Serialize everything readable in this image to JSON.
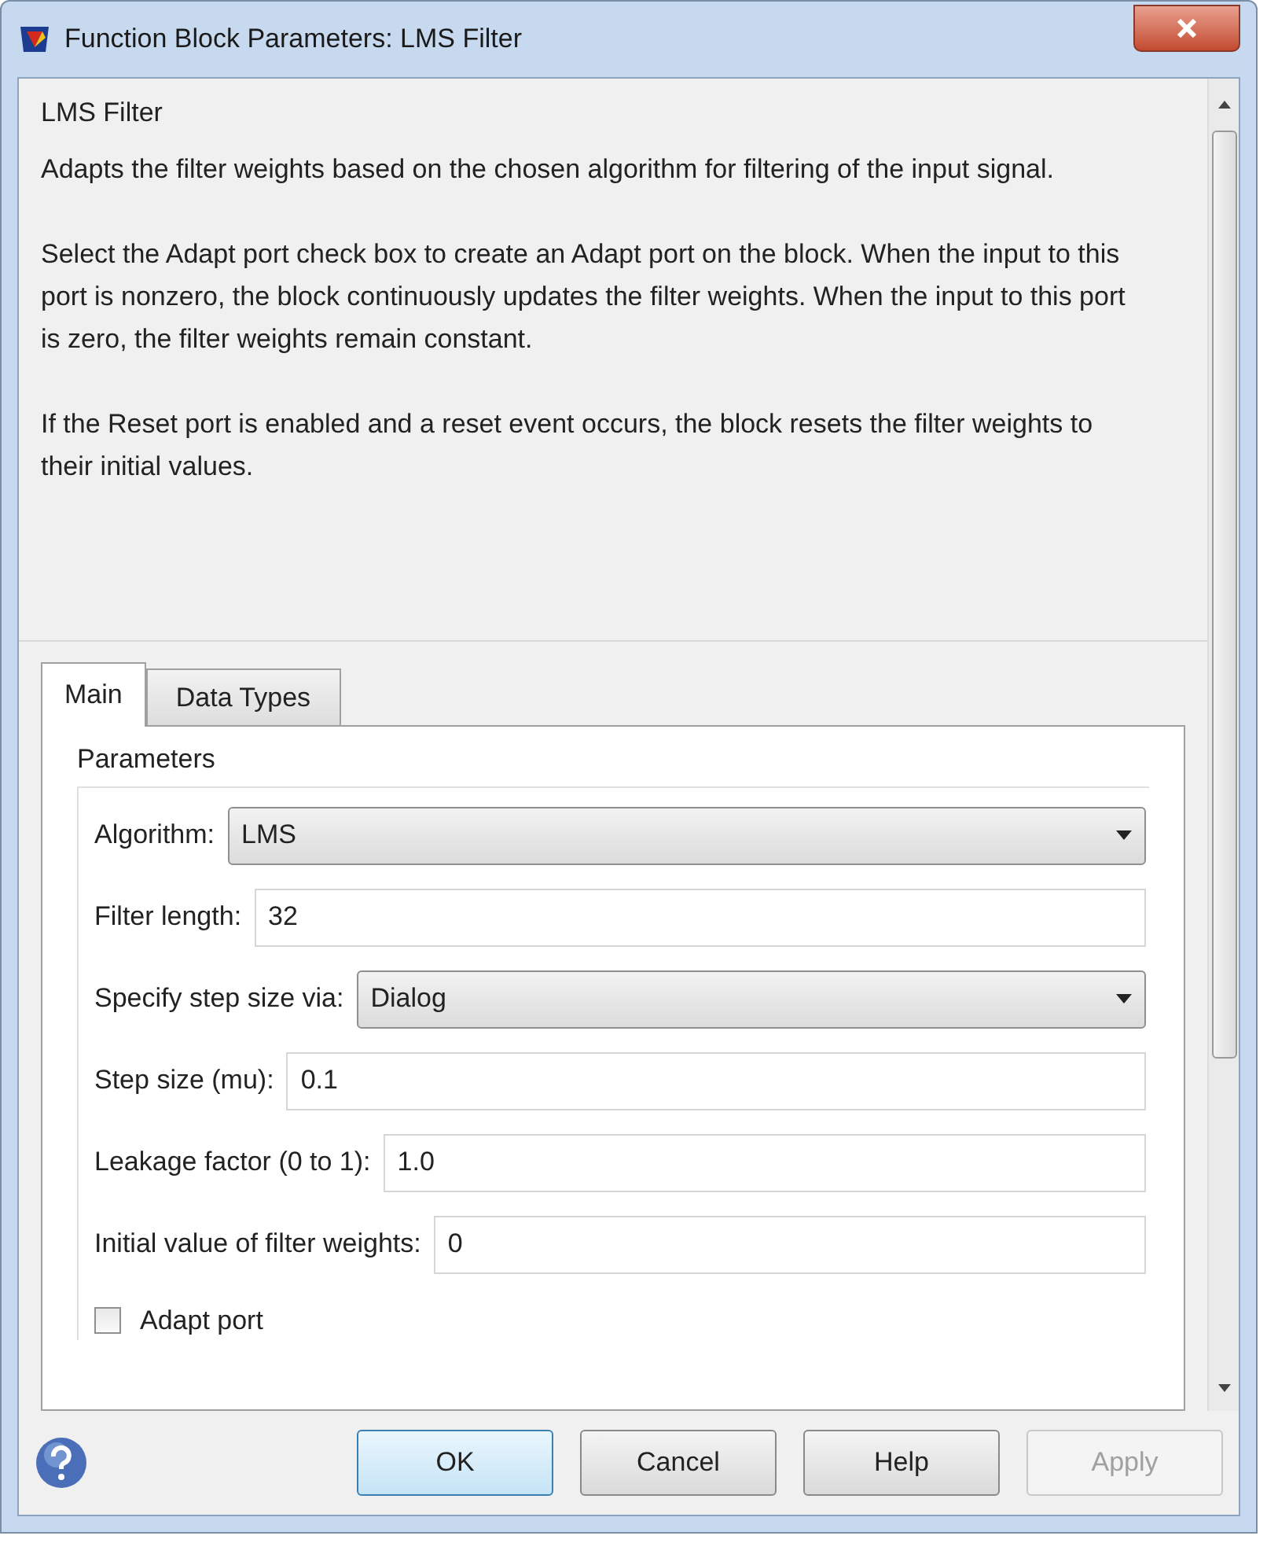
{
  "window": {
    "title": "Function Block Parameters: LMS Filter"
  },
  "description": {
    "heading": "LMS Filter",
    "paragraphs": [
      "Adapts the filter weights based on the chosen algorithm for filtering of the input signal.",
      "Select the Adapt port check box to create an Adapt port on the block. When the input to this port is nonzero, the block continuously updates the filter weights. When the input to this port is zero, the filter weights remain constant.",
      "If the Reset port is enabled and a reset event occurs, the block resets the filter weights to their initial values."
    ]
  },
  "tabs": [
    {
      "label": "Main",
      "selected": true
    },
    {
      "label": "Data Types",
      "selected": false
    }
  ],
  "parameters": {
    "title": "Parameters",
    "items": [
      {
        "kind": "dropdown",
        "label": "Algorithm:",
        "value": "LMS"
      },
      {
        "kind": "text",
        "label": "Filter length:",
        "value": "32"
      },
      {
        "kind": "dropdown",
        "label": "Specify step size via:",
        "value": "Dialog"
      },
      {
        "kind": "text",
        "label": "Step size (mu):",
        "value": "0.1"
      },
      {
        "kind": "text",
        "label": "Leakage factor (0 to 1):",
        "value": "1.0"
      },
      {
        "kind": "text",
        "label": "Initial value of filter weights:",
        "value": "0"
      },
      {
        "kind": "checkbox",
        "label": "Adapt port",
        "checked": false
      }
    ]
  },
  "buttons": [
    {
      "label": "OK",
      "disabled": false,
      "default": true
    },
    {
      "label": "Cancel",
      "disabled": false,
      "default": false
    },
    {
      "label": "Help",
      "disabled": false,
      "default": false
    },
    {
      "label": "Apply",
      "disabled": true,
      "default": false
    }
  ]
}
